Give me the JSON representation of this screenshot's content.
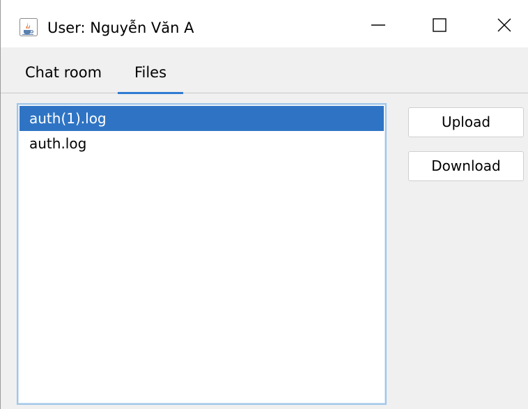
{
  "window": {
    "title": "User: Nguyễn Văn A",
    "app_icon": "java-cup-icon",
    "controls": [
      "minimize-icon",
      "maximize-icon",
      "close-icon"
    ]
  },
  "tabs": [
    {
      "label": "Chat room",
      "active": false
    },
    {
      "label": "Files",
      "active": true
    }
  ],
  "files": {
    "items": [
      {
        "name": "auth(1).log",
        "selected": true
      },
      {
        "name": "auth.log",
        "selected": false
      }
    ]
  },
  "actions": {
    "upload_label": "Upload",
    "download_label": "Download"
  },
  "colors": {
    "accent": "#2f7cd3",
    "selection": "#2f74c4",
    "list_border": "#9fc6ea",
    "background": "#f0f0f0"
  }
}
